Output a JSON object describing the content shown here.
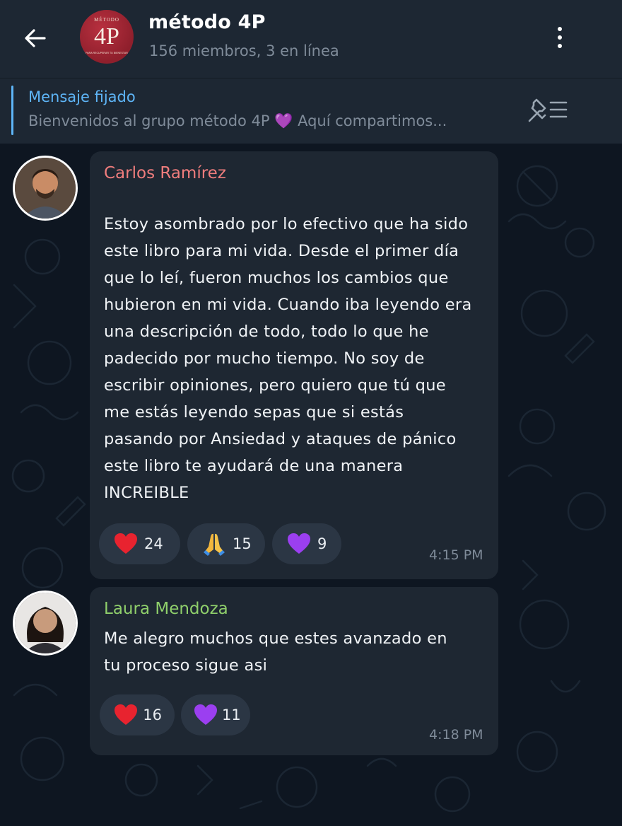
{
  "header": {
    "back_icon": "arrow-left-icon",
    "group_name": "método 4P",
    "group_subtitle": "156 miembros, 3 en línea",
    "group_avatar": {
      "top_text": "MÉTODO",
      "main_text": "4P",
      "bottom_text": "PARA RECUPERAR TU BIENESTAR"
    },
    "menu_icon": "more-vertical-icon"
  },
  "pinned": {
    "label": "Mensaje fijado",
    "text": "Bienvenidos al grupo método 4P 💜 Aquí compartimos...",
    "icon": "pin-list-icon",
    "accent_color": "#5eb5f7"
  },
  "messages": [
    {
      "sender": "Carlos Ramírez",
      "sender_color": "#f07d7d",
      "avatar_icon": "user-avatar-carlos",
      "text": "Estoy asombrado por lo efectivo que ha sido\neste libro para mi vida. Desde el primer día\nque lo leí, fueron muchos los cambios que\nhubieron en mi vida. Cuando iba leyendo era\nuna descripción de todo, todo lo que he\npadecido por mucho tiempo. No soy de\nescribir opiniones, pero quiero que tú que\nme estás leyendo sepas que si estás\npasando por Ansiedad y ataques de pánico\neste libro te ayudará de una manera\nINCREIBLE",
      "time": "4:15 PM",
      "reactions": [
        {
          "emoji": "heart-red-emoji",
          "count": "24"
        },
        {
          "emoji": "folded-hands-emoji",
          "count": "15"
        },
        {
          "emoji": "heart-purple-emoji",
          "count": "9"
        }
      ]
    },
    {
      "sender": "Laura Mendoza",
      "sender_color": "#8fcf6b",
      "avatar_icon": "user-avatar-laura",
      "text": "Me alegro muchos que estes avanzado en\ntu proceso sigue asi",
      "time": "4:18 PM",
      "reactions": [
        {
          "emoji": "heart-red-emoji",
          "count": "16"
        },
        {
          "emoji": "heart-purple-emoji",
          "count": "11"
        }
      ]
    }
  ]
}
